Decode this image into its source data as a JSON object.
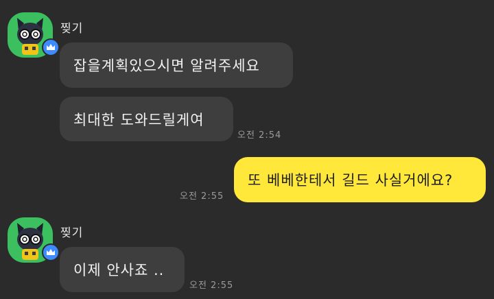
{
  "messages": [
    {
      "sender": "찢기",
      "avatar_icon": "cat-with-glasses-profile-icon",
      "badge_icon": "crown-icon",
      "bubbles": [
        {
          "text": "잡을계획있으시면 알려주세요"
        },
        {
          "text": "최대한 도와드릴게여",
          "time": "오전 2:54"
        }
      ]
    },
    {
      "sender": "me",
      "bubbles": [
        {
          "text": "또 베베한테서 길드 사실거에요?",
          "time": "오전 2:55"
        }
      ]
    },
    {
      "sender": "찢기",
      "avatar_icon": "cat-with-glasses-profile-icon",
      "badge_icon": "crown-icon",
      "bubbles": [
        {
          "text": "이제 안사죠 ..",
          "time": "오전 2:55"
        }
      ]
    }
  ],
  "colors": {
    "background": "#2b2b2b",
    "incoming_bubble": "#3e3e3e",
    "outgoing_bubble": "#ffe83a",
    "avatar_bg": "#3bbf5f",
    "crown_badge": "#3d8bff"
  }
}
